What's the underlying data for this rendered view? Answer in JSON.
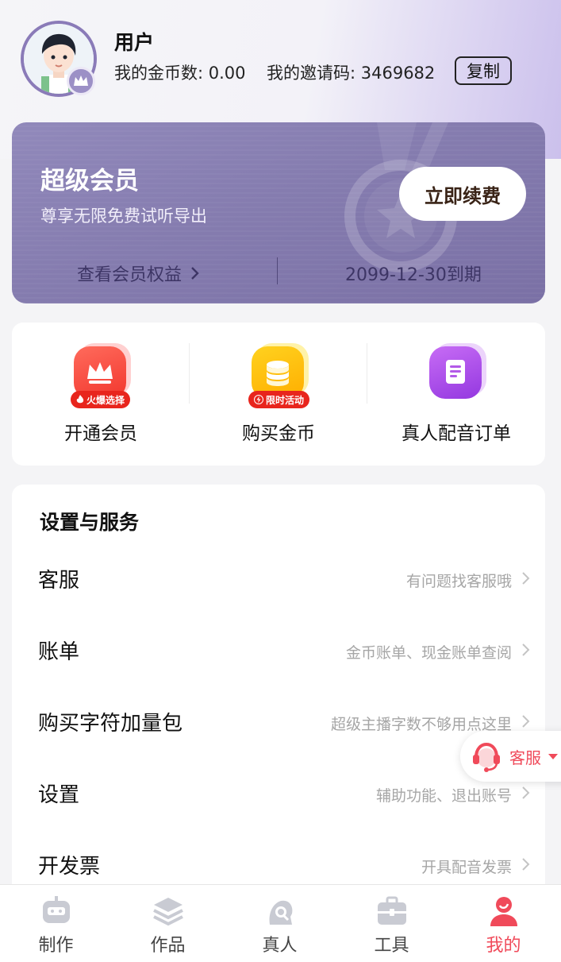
{
  "profile": {
    "name": "用户",
    "coins": "我的金币数: 0.00",
    "invite": "我的邀请码: 3469682",
    "copy_label": "复制"
  },
  "vip": {
    "title": "超级会员",
    "subtitle": "尊享无限免费试听导出",
    "renew_label": "立即续费",
    "benefits_label": "查看会员权益",
    "expiry": "2099-12-30到期"
  },
  "quick_actions": [
    {
      "label": "开通会员",
      "tag": "火爆选择",
      "icon": "crown-icon",
      "color": "red"
    },
    {
      "label": "购买金币",
      "tag": "限时活动",
      "icon": "coin-stack-icon",
      "color": "gold"
    },
    {
      "label": "真人配音订单",
      "tag": "",
      "icon": "order-document-icon",
      "color": "purple"
    }
  ],
  "settings": {
    "title": "设置与服务",
    "items": [
      {
        "label": "客服",
        "hint": "有问题找客服哦"
      },
      {
        "label": "账单",
        "hint": "金币账单、现金账单查阅"
      },
      {
        "label": "购买字符加量包",
        "hint": "超级主播字数不够用点这里"
      },
      {
        "label": "设置",
        "hint": "辅助功能、退出账号"
      },
      {
        "label": "开发票",
        "hint": "开具配音发票"
      }
    ]
  },
  "floating_service": {
    "label": "客服",
    "icon": "headset-icon"
  },
  "tabs": [
    {
      "label": "制作",
      "icon": "robot-icon",
      "active": false
    },
    {
      "label": "作品",
      "icon": "layers-icon",
      "active": false
    },
    {
      "label": "真人",
      "icon": "person-search-icon",
      "active": false
    },
    {
      "label": "工具",
      "icon": "toolbox-icon",
      "active": false
    },
    {
      "label": "我的",
      "icon": "profile-icon",
      "active": true
    }
  ],
  "colors": {
    "accent": "#f04a5a",
    "vip_card": "#857caf",
    "inactive_icon": "#c9cbd3"
  }
}
